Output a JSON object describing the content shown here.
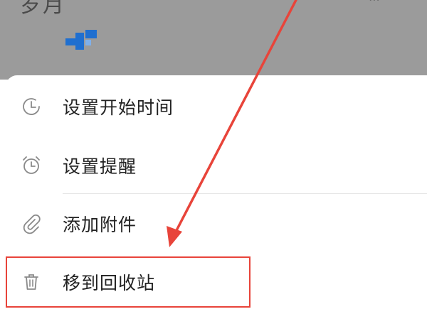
{
  "header": {
    "title": "岁月",
    "right_glyph": "⋯"
  },
  "menu": {
    "items": [
      {
        "label": "设置开始时间",
        "icon": "clock-icon"
      },
      {
        "label": "设置提醒",
        "icon": "alarm-clock-icon"
      },
      {
        "label": "添加附件",
        "icon": "paperclip-icon"
      },
      {
        "label": "移到回收站",
        "icon": "trash-icon"
      }
    ]
  },
  "colors": {
    "dim_header": "#9b9b9b",
    "highlight": "#e8443a",
    "arrow": "#e8443a",
    "logo_blue": "#1f6fd0",
    "icon_gray": "#8a8a8a"
  }
}
